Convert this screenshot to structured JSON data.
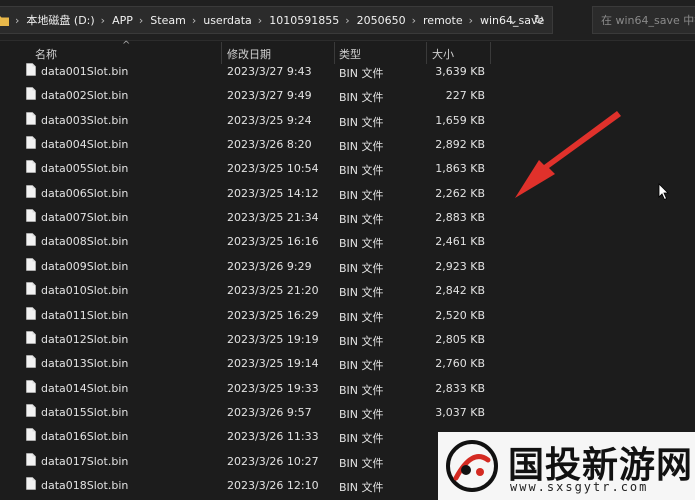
{
  "address_bar": {
    "crumbs": [
      "本地磁盘 (D:)",
      "APP",
      "Steam",
      "userdata",
      "1010591855",
      "2050650",
      "remote",
      "win64_save"
    ]
  },
  "search": {
    "placeholder": "在 win64_save 中搜索"
  },
  "columns": {
    "name": "名称",
    "date": "修改日期",
    "type": "类型",
    "size": "大小"
  },
  "files": [
    {
      "name": "data001Slot.bin",
      "date": "2023/3/27 9:43",
      "type": "BIN 文件",
      "size": "3,639 KB"
    },
    {
      "name": "data002Slot.bin",
      "date": "2023/3/27 9:49",
      "type": "BIN 文件",
      "size": "227 KB"
    },
    {
      "name": "data003Slot.bin",
      "date": "2023/3/25 9:24",
      "type": "BIN 文件",
      "size": "1,659 KB"
    },
    {
      "name": "data004Slot.bin",
      "date": "2023/3/26 8:20",
      "type": "BIN 文件",
      "size": "2,892 KB"
    },
    {
      "name": "data005Slot.bin",
      "date": "2023/3/25 10:54",
      "type": "BIN 文件",
      "size": "1,863 KB"
    },
    {
      "name": "data006Slot.bin",
      "date": "2023/3/25 14:12",
      "type": "BIN 文件",
      "size": "2,262 KB"
    },
    {
      "name": "data007Slot.bin",
      "date": "2023/3/25 21:34",
      "type": "BIN 文件",
      "size": "2,883 KB"
    },
    {
      "name": "data008Slot.bin",
      "date": "2023/3/25 16:16",
      "type": "BIN 文件",
      "size": "2,461 KB"
    },
    {
      "name": "data009Slot.bin",
      "date": "2023/3/26 9:29",
      "type": "BIN 文件",
      "size": "2,923 KB"
    },
    {
      "name": "data010Slot.bin",
      "date": "2023/3/25 21:20",
      "type": "BIN 文件",
      "size": "2,842 KB"
    },
    {
      "name": "data011Slot.bin",
      "date": "2023/3/25 16:29",
      "type": "BIN 文件",
      "size": "2,520 KB"
    },
    {
      "name": "data012Slot.bin",
      "date": "2023/3/25 19:19",
      "type": "BIN 文件",
      "size": "2,805 KB"
    },
    {
      "name": "data013Slot.bin",
      "date": "2023/3/25 19:14",
      "type": "BIN 文件",
      "size": "2,760 KB"
    },
    {
      "name": "data014Slot.bin",
      "date": "2023/3/25 19:33",
      "type": "BIN 文件",
      "size": "2,833 KB"
    },
    {
      "name": "data015Slot.bin",
      "date": "2023/3/26 9:57",
      "type": "BIN 文件",
      "size": "3,037 KB"
    },
    {
      "name": "data016Slot.bin",
      "date": "2023/3/26 11:33",
      "type": "BIN 文件",
      "size": ""
    },
    {
      "name": "data017Slot.bin",
      "date": "2023/3/26 10:27",
      "type": "BIN 文件",
      "size": ""
    },
    {
      "name": "data018Slot.bin",
      "date": "2023/3/26 12:10",
      "type": "BIN 文件",
      "size": ""
    }
  ],
  "watermark": {
    "text": "国投新游网",
    "url": "www.sxsgytr.com"
  },
  "icons": {
    "folder": "folder-icon",
    "file": "file-icon",
    "dropdown": "chevron-down-icon",
    "refresh": "refresh-icon",
    "arrow": "red-arrow-annotation",
    "cursor": "mouse-cursor-icon"
  },
  "colors": {
    "background": "#1c1c1c",
    "annotation_arrow": "#e0312b",
    "folder": "#e8b84a"
  }
}
